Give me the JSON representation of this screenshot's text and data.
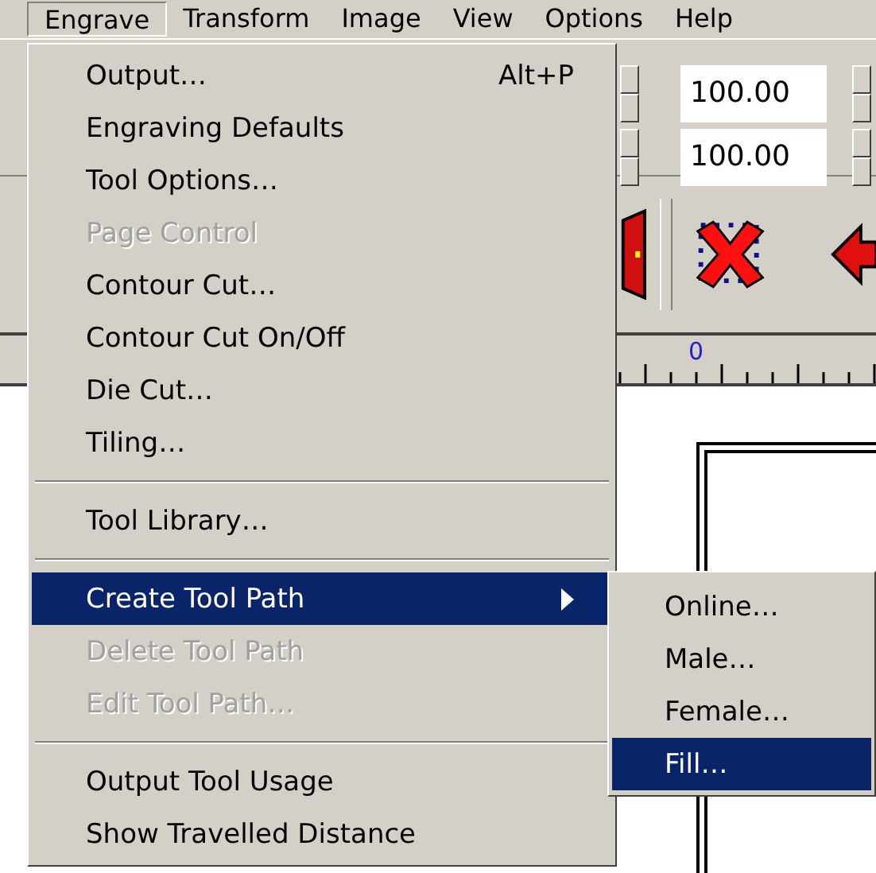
{
  "menu_bar": [
    {
      "label": "Engrave",
      "selected": true
    },
    {
      "label": "Transform",
      "selected": false
    },
    {
      "label": "Image",
      "selected": false
    },
    {
      "label": "View",
      "selected": false
    },
    {
      "label": "Options",
      "selected": false
    },
    {
      "label": "Help",
      "selected": false
    }
  ],
  "toolbar_fields": [
    {
      "value": "100.00"
    },
    {
      "value": "100.00"
    }
  ],
  "ruler": {
    "label": "0"
  },
  "engrave_menu": [
    {
      "kind": "item",
      "label": "Output…",
      "shortcut": "Alt+P",
      "disabled": false,
      "selected": false
    },
    {
      "kind": "item",
      "label": "Engraving Defaults",
      "disabled": false,
      "selected": false
    },
    {
      "kind": "item",
      "label": "Tool Options…",
      "disabled": false,
      "selected": false
    },
    {
      "kind": "item",
      "label": "Page Control",
      "disabled": true,
      "selected": false
    },
    {
      "kind": "item",
      "label": "Contour Cut…",
      "disabled": false,
      "selected": false
    },
    {
      "kind": "item",
      "label": "Contour Cut On/Off",
      "disabled": false,
      "selected": false
    },
    {
      "kind": "item",
      "label": "Die Cut…",
      "disabled": false,
      "selected": false
    },
    {
      "kind": "item",
      "label": "Tiling…",
      "disabled": false,
      "selected": false
    },
    {
      "kind": "separator"
    },
    {
      "kind": "item",
      "label": "Tool Library…",
      "disabled": false,
      "selected": false
    },
    {
      "kind": "separator"
    },
    {
      "kind": "submenu",
      "label": "Create Tool Path",
      "disabled": false,
      "selected": true
    },
    {
      "kind": "item",
      "label": "Delete Tool Path",
      "disabled": true,
      "selected": false
    },
    {
      "kind": "item",
      "label": "Edit Tool Path…",
      "disabled": true,
      "selected": false
    },
    {
      "kind": "separator"
    },
    {
      "kind": "item",
      "label": "Output Tool Usage",
      "disabled": false,
      "selected": false
    },
    {
      "kind": "item",
      "label": "Show Travelled Distance",
      "disabled": false,
      "selected": false
    }
  ],
  "submenu": [
    {
      "label": "Online…",
      "selected": false
    },
    {
      "label": "Male…",
      "selected": false
    },
    {
      "label": "Female…",
      "selected": false
    },
    {
      "label": "Fill…",
      "selected": true
    }
  ]
}
